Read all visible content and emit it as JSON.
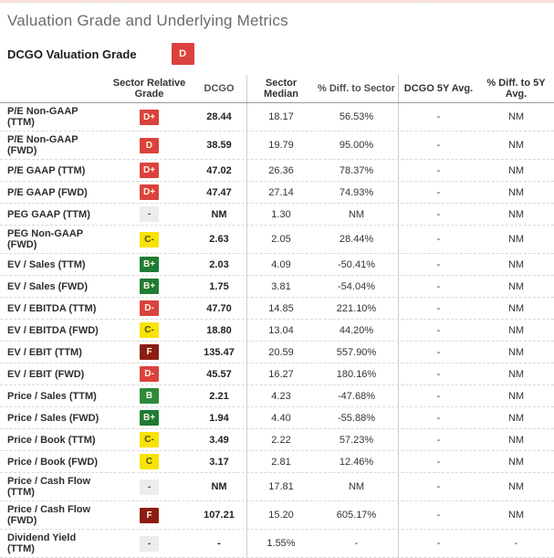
{
  "page": {
    "title": "Valuation Grade and Underlying Metrics"
  },
  "summary": {
    "label": "DCGO Valuation Grade",
    "grade": "D",
    "grade_color": "red"
  },
  "palette": {
    "red": "#db423d",
    "maroon": "#8c1d13",
    "yellow": "#f8e303",
    "green": "#2e8b3a",
    "green_dark": "#1e7c33",
    "gray": "#ececec",
    "badge_text_light": "#fff8e0",
    "badge_text_dark": "#4a4a15",
    "divider": "#cccccc",
    "top_band": "#f6e2de"
  },
  "table": {
    "headers": [
      "",
      "Sector Relative Grade",
      "DCGO",
      "Sector Median",
      "% Diff. to Sector",
      "DCGO 5Y Avg.",
      "% Diff. to 5Y Avg."
    ],
    "rows": [
      {
        "metric": "P/E Non-GAAP (TTM)",
        "grade": "D+",
        "grade_color": "red",
        "dcgo": "28.44",
        "sector_median": "18.17",
        "diff_sector": "56.53%",
        "avg_5y": "-",
        "diff_5y": "NM"
      },
      {
        "metric": "P/E Non-GAAP (FWD)",
        "grade": "D",
        "grade_color": "red",
        "dcgo": "38.59",
        "sector_median": "19.79",
        "diff_sector": "95.00%",
        "avg_5y": "-",
        "diff_5y": "NM"
      },
      {
        "metric": "P/E GAAP (TTM)",
        "grade": "D+",
        "grade_color": "red",
        "dcgo": "47.02",
        "sector_median": "26.36",
        "diff_sector": "78.37%",
        "avg_5y": "-",
        "diff_5y": "NM"
      },
      {
        "metric": "P/E GAAP (FWD)",
        "grade": "D+",
        "grade_color": "red",
        "dcgo": "47.47",
        "sector_median": "27.14",
        "diff_sector": "74.93%",
        "avg_5y": "-",
        "diff_5y": "NM"
      },
      {
        "metric": "PEG GAAP (TTM)",
        "grade": "-",
        "grade_color": "gray",
        "dcgo": "NM",
        "sector_median": "1.30",
        "diff_sector": "NM",
        "avg_5y": "-",
        "diff_5y": "NM"
      },
      {
        "metric": "PEG Non-GAAP (FWD)",
        "grade": "C-",
        "grade_color": "yellow",
        "dcgo": "2.63",
        "sector_median": "2.05",
        "diff_sector": "28.44%",
        "avg_5y": "-",
        "diff_5y": "NM"
      },
      {
        "metric": "EV / Sales (TTM)",
        "grade": "B+",
        "grade_color": "green_dark",
        "dcgo": "2.03",
        "sector_median": "4.09",
        "diff_sector": "-50.41%",
        "avg_5y": "-",
        "diff_5y": "NM"
      },
      {
        "metric": "EV / Sales (FWD)",
        "grade": "B+",
        "grade_color": "green_dark",
        "dcgo": "1.75",
        "sector_median": "3.81",
        "diff_sector": "-54.04%",
        "avg_5y": "-",
        "diff_5y": "NM"
      },
      {
        "metric": "EV / EBITDA (TTM)",
        "grade": "D-",
        "grade_color": "red",
        "dcgo": "47.70",
        "sector_median": "14.85",
        "diff_sector": "221.10%",
        "avg_5y": "-",
        "diff_5y": "NM"
      },
      {
        "metric": "EV / EBITDA (FWD)",
        "grade": "C-",
        "grade_color": "yellow",
        "dcgo": "18.80",
        "sector_median": "13.04",
        "diff_sector": "44.20%",
        "avg_5y": "-",
        "diff_5y": "NM"
      },
      {
        "metric": "EV / EBIT (TTM)",
        "grade": "F",
        "grade_color": "maroon",
        "dcgo": "135.47",
        "sector_median": "20.59",
        "diff_sector": "557.90%",
        "avg_5y": "-",
        "diff_5y": "NM"
      },
      {
        "metric": "EV / EBIT (FWD)",
        "grade": "D-",
        "grade_color": "red",
        "dcgo": "45.57",
        "sector_median": "16.27",
        "diff_sector": "180.16%",
        "avg_5y": "-",
        "diff_5y": "NM"
      },
      {
        "metric": "Price / Sales (TTM)",
        "grade": "B",
        "grade_color": "green",
        "dcgo": "2.21",
        "sector_median": "4.23",
        "diff_sector": "-47.68%",
        "avg_5y": "-",
        "diff_5y": "NM"
      },
      {
        "metric": "Price / Sales (FWD)",
        "grade": "B+",
        "grade_color": "green_dark",
        "dcgo": "1.94",
        "sector_median": "4.40",
        "diff_sector": "-55.88%",
        "avg_5y": "-",
        "diff_5y": "NM"
      },
      {
        "metric": "Price / Book (TTM)",
        "grade": "C-",
        "grade_color": "yellow",
        "dcgo": "3.49",
        "sector_median": "2.22",
        "diff_sector": "57.23%",
        "avg_5y": "-",
        "diff_5y": "NM"
      },
      {
        "metric": "Price / Book (FWD)",
        "grade": "C",
        "grade_color": "yellow",
        "dcgo": "3.17",
        "sector_median": "2.81",
        "diff_sector": "12.46%",
        "avg_5y": "-",
        "diff_5y": "NM"
      },
      {
        "metric": "Price / Cash Flow (TTM)",
        "grade": "-",
        "grade_color": "gray",
        "dcgo": "NM",
        "sector_median": "17.81",
        "diff_sector": "NM",
        "avg_5y": "-",
        "diff_5y": "NM"
      },
      {
        "metric": "Price / Cash Flow (FWD)",
        "grade": "F",
        "grade_color": "maroon",
        "dcgo": "107.21",
        "sector_median": "15.20",
        "diff_sector": "605.17%",
        "avg_5y": "-",
        "diff_5y": "NM"
      },
      {
        "metric": "Dividend Yield (TTM)",
        "grade": "-",
        "grade_color": "gray",
        "dcgo": "-",
        "sector_median": "1.55%",
        "diff_sector": "-",
        "avg_5y": "-",
        "diff_5y": "-"
      }
    ]
  }
}
